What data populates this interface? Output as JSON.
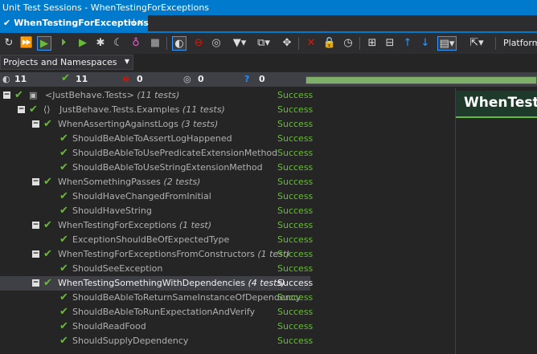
{
  "window_title": "Unit Test Sessions - WhenTestingForExceptions",
  "tab": {
    "label": "WhenTestingForExceptions",
    "pin": "⊣",
    "close": "×"
  },
  "toolbar": {
    "platform_label": "Platform"
  },
  "grouping": {
    "selected": "Projects and Namespaces"
  },
  "stats": {
    "total": "11",
    "passed": "11",
    "failed": "0",
    "ignored": "0",
    "unknown": "0"
  },
  "progress": 1.0,
  "colors": {
    "accent": "#007acc",
    "success": "#6aba3a",
    "failed": "#e51400",
    "info": "#1e90ff"
  },
  "tree": [
    {
      "label": "<JustBehave.Tests>",
      "count": "(11 tests)",
      "status": "Success"
    },
    {
      "label": "JustBehave.Tests.Examples",
      "count": "(11 tests)",
      "status": "Success"
    },
    {
      "label": "WhenAssertingAgainstLogs",
      "count": "(3 tests)",
      "status": "Success"
    },
    {
      "label": "ShouldBeAbleToAssertLogHappened",
      "count": "",
      "status": "Success"
    },
    {
      "label": "ShouldBeAbleToUsePredicateExtensionMethod",
      "count": "",
      "status": "Success"
    },
    {
      "label": "ShouldBeAbleToUseStringExtensionMethod",
      "count": "",
      "status": "Success"
    },
    {
      "label": "WhenSomethingPasses",
      "count": "(2 tests)",
      "status": "Success"
    },
    {
      "label": "ShouldHaveChangedFromInitial",
      "count": "",
      "status": "Success"
    },
    {
      "label": "ShouldHaveString",
      "count": "",
      "status": "Success"
    },
    {
      "label": "WhenTestingForExceptions",
      "count": "(1 test)",
      "status": "Success"
    },
    {
      "label": "ExceptionShouldBeOfExpectedType",
      "count": "",
      "status": "Success"
    },
    {
      "label": "WhenTestingForExceptionsFromConstructors",
      "count": "(1 test)",
      "status": "Success"
    },
    {
      "label": "ShouldSeeException",
      "count": "",
      "status": "Success"
    },
    {
      "label": "WhenTestingSomethingWithDependencies",
      "count": "(4 tests)",
      "status": "Success"
    },
    {
      "label": "ShouldBeAbleToReturnSameInstanceOfDependency",
      "count": "",
      "status": "Success"
    },
    {
      "label": "ShouldBeAbleToRunExpectationAndVerify",
      "count": "",
      "status": "Success"
    },
    {
      "label": "ShouldReadFood",
      "count": "",
      "status": "Success"
    },
    {
      "label": "ShouldSupplyDependency",
      "count": "",
      "status": "Success"
    }
  ],
  "detail": {
    "title": "WhenTestingForExceptions"
  }
}
